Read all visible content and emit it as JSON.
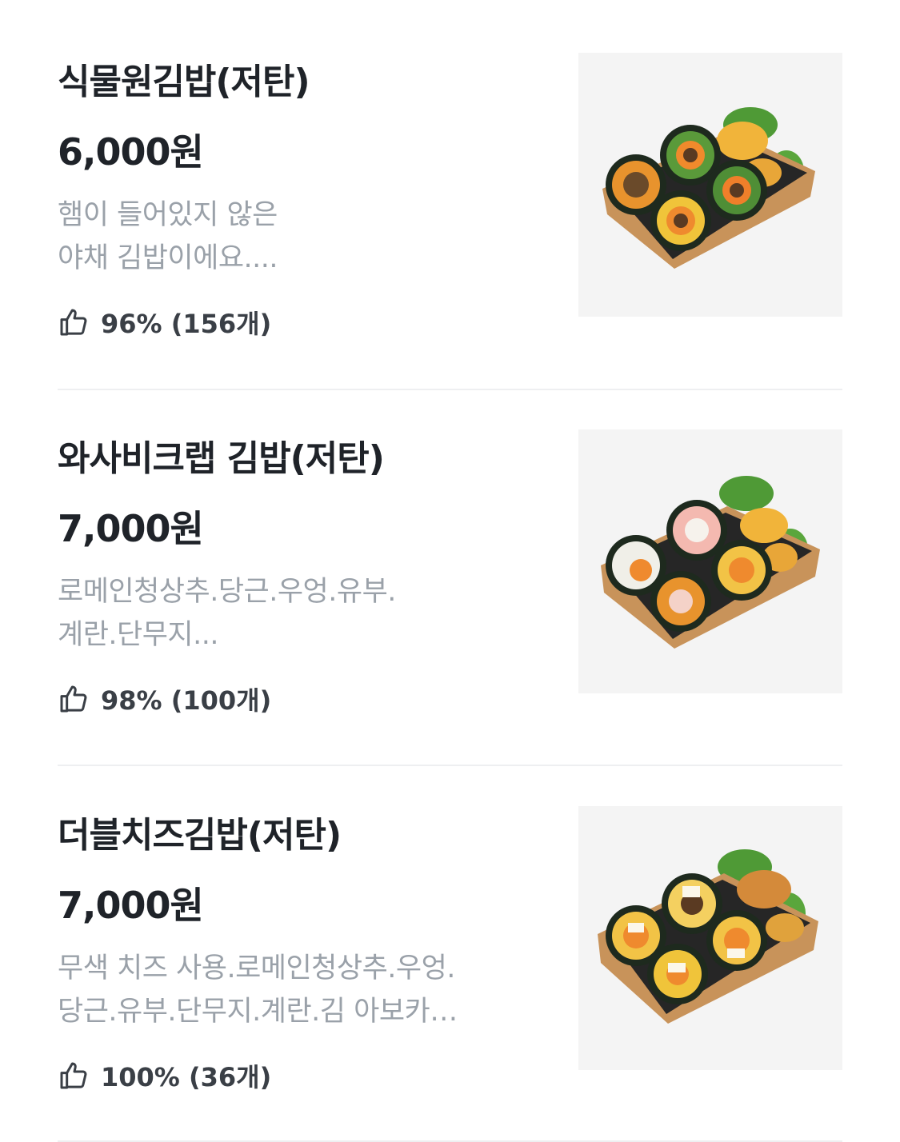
{
  "menu_items": [
    {
      "name": "식물원김밥(저탄)",
      "price": "6,000원",
      "description_lines": [
        "햄이 들어있지 않은",
        "야채 김밥이에요...."
      ],
      "rating": "96% (156개)",
      "image_icon": "kimbap-tray-photo"
    },
    {
      "name": "와사비크랩 김밥(저탄)",
      "price": "7,000원",
      "description_lines": [
        "로메인청상추.당근.우엉.유부.",
        "계란.단무지..."
      ],
      "rating": "98% (100개)",
      "image_icon": "kimbap-tray-photo"
    },
    {
      "name": "더블치즈김밥(저탄)",
      "price": "7,000원",
      "description_lines": [
        "무색 치즈 사용.로메인청상추.우엉.",
        "당근.유부.단무지.계란.김 아보카…"
      ],
      "rating": "100% (36개)",
      "image_icon": "kimbap-tray-photo"
    }
  ],
  "colors": {
    "title": "#1f2329",
    "description": "#9aa1a9",
    "rating": "#3a3f46",
    "divider": "#eeeff1"
  }
}
